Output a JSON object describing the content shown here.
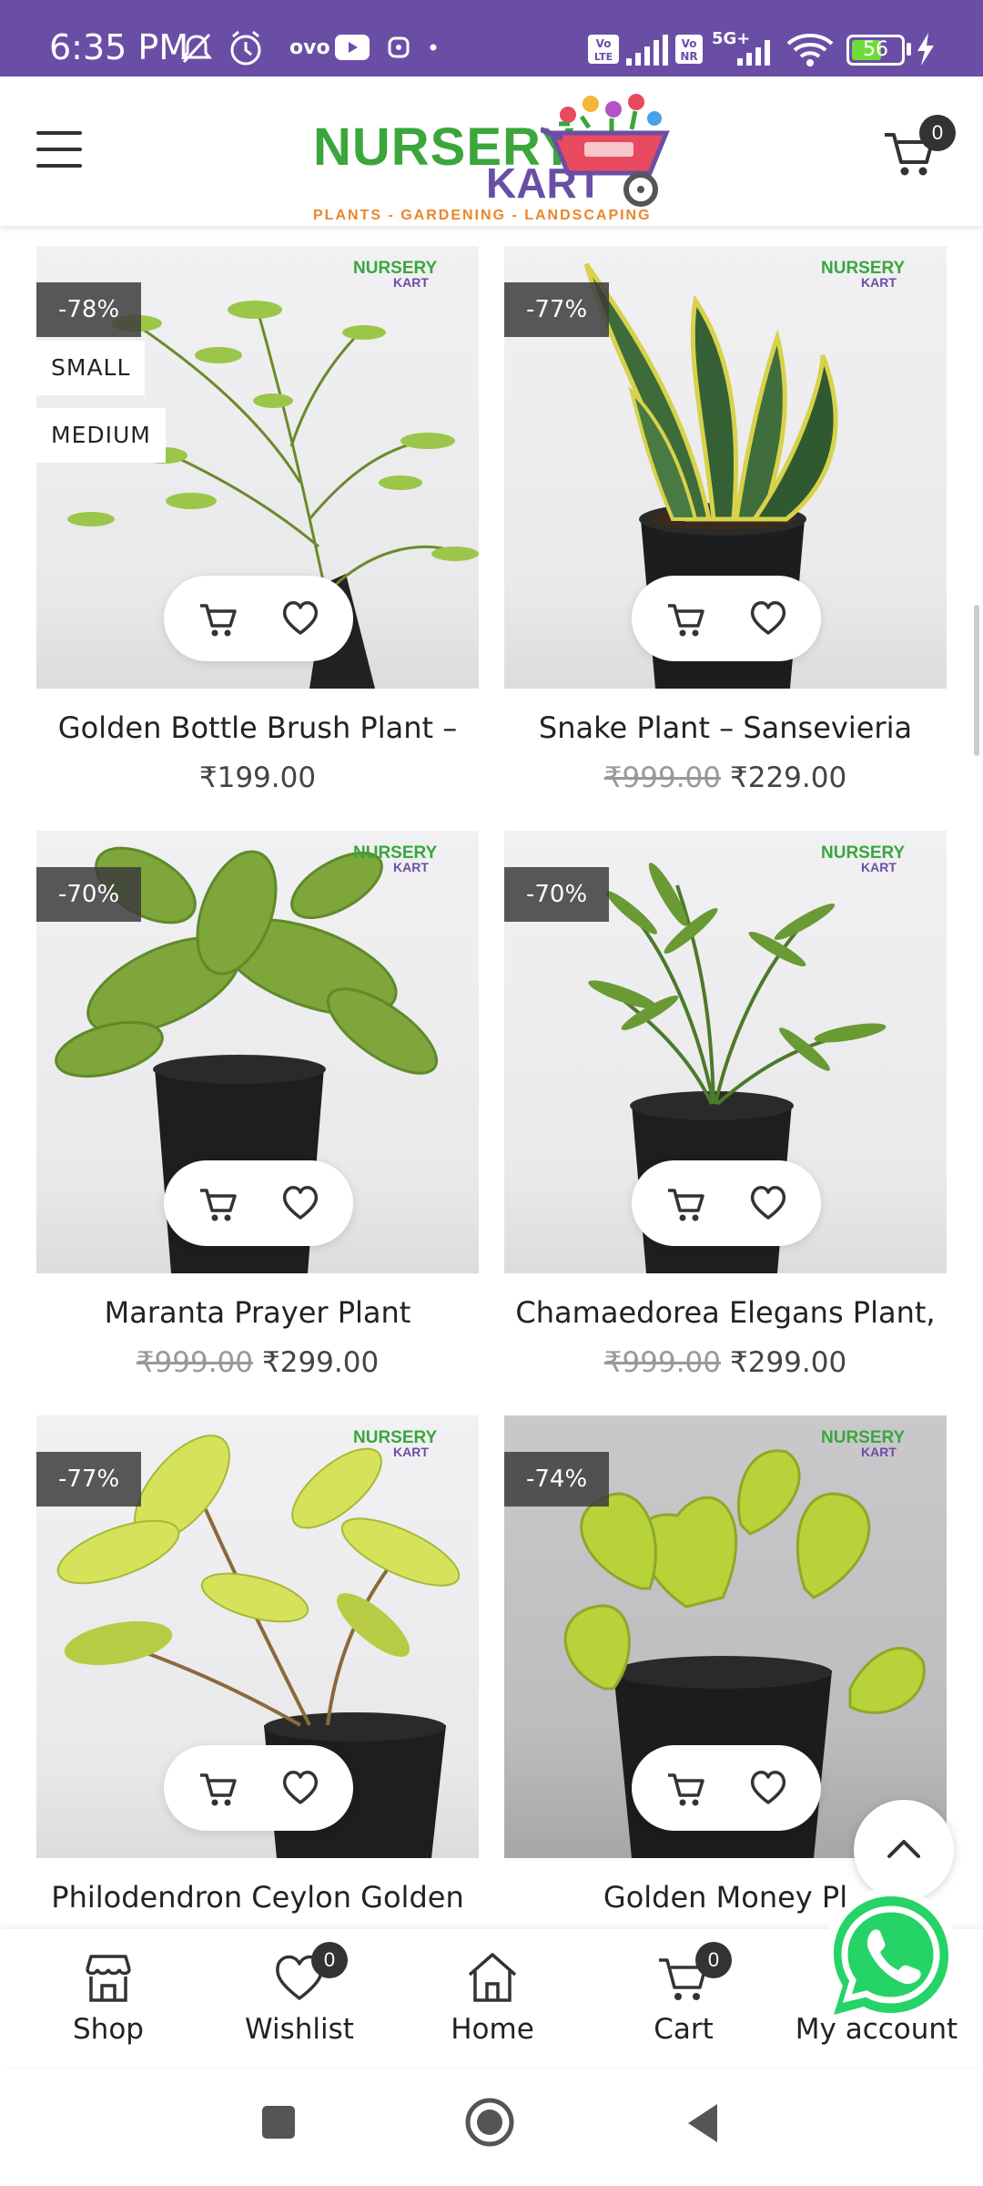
{
  "status_bar": {
    "time": "6:35 PM",
    "icons": [
      "mute-icon",
      "alarm-icon",
      "ovo-icon",
      "youtube-icon",
      "app-icon",
      "dot-icon",
      "volte-icon",
      "signal-icon",
      "vonr-icon",
      "signal-5g-icon",
      "wifi-icon",
      "battery-icon",
      "charging-icon"
    ],
    "ovo_label": "ovo",
    "network_label": "5G+",
    "volte_label": "Vo LTE",
    "vonr_label": "Vo NR",
    "battery_level": "56"
  },
  "header": {
    "logo_line1": "NURSERY",
    "logo_line2": "KART",
    "logo_tagline": "PLANTS - GARDENING - LANDSCAPING",
    "cart_count": "0"
  },
  "watermark": {
    "line1": "NURSERY",
    "line2": "KART"
  },
  "colors": {
    "brand_purple": "#6a4ea6",
    "brand_green": "#3aa63c",
    "brand_orange": "#e9862a",
    "whatsapp_green": "#25d366"
  },
  "products": [
    {
      "discount": "-78%",
      "tags": [
        "SMALL",
        "MEDIUM"
      ],
      "title": "Golden Bottle Brush Plant –",
      "old_price": "",
      "price": "₹199.00"
    },
    {
      "discount": "-77%",
      "tags": [],
      "title": "Snake Plant – Sansevieria",
      "old_price": "₹999.00",
      "price": "₹229.00"
    },
    {
      "discount": "-70%",
      "tags": [],
      "title": "Maranta Prayer Plant",
      "old_price": "₹999.00",
      "price": "₹299.00"
    },
    {
      "discount": "-70%",
      "tags": [],
      "title": "Chamaedorea Elegans Plant,",
      "old_price": "₹999.00",
      "price": "₹299.00"
    },
    {
      "discount": "-77%",
      "tags": [],
      "title": "Philodendron Ceylon Golden",
      "old_price": "",
      "price": ""
    },
    {
      "discount": "-74%",
      "tags": [],
      "title": "Golden Money Pl",
      "old_price": "",
      "price": ""
    }
  ],
  "bottom_nav": [
    {
      "label": "Shop",
      "icon": "shop-icon",
      "count": ""
    },
    {
      "label": "Wishlist",
      "icon": "heart-icon",
      "count": "0"
    },
    {
      "label": "Home",
      "icon": "home-icon",
      "count": ""
    },
    {
      "label": "Cart",
      "icon": "cart-icon",
      "count": "0"
    },
    {
      "label": "My account",
      "icon": "user-icon",
      "count": ""
    }
  ],
  "system_nav": [
    "recents-button",
    "home-button",
    "back-button"
  ]
}
